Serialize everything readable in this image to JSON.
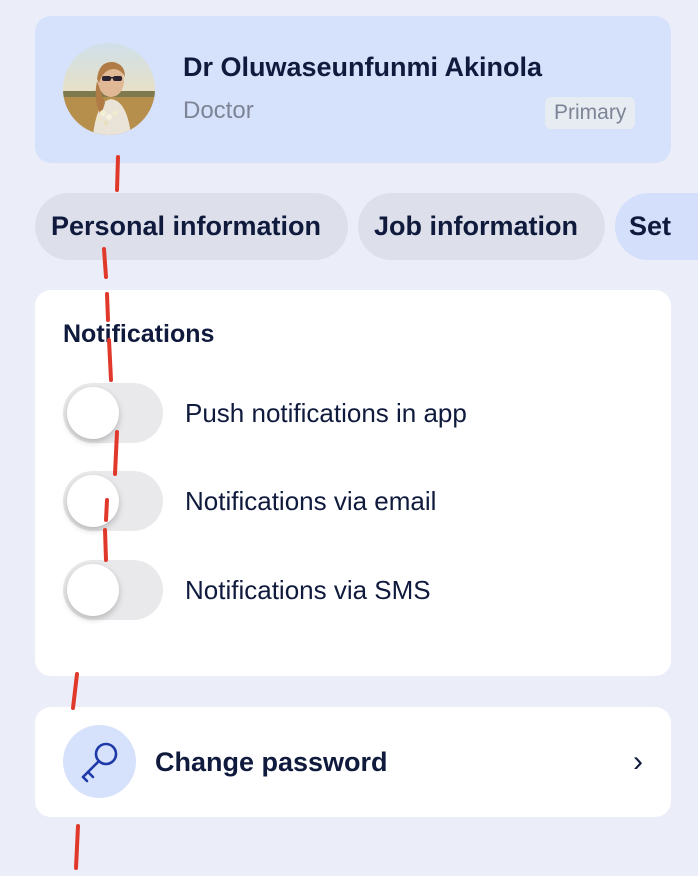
{
  "profile": {
    "name": "Dr Oluwaseunfunmi Akinola",
    "role": "Doctor",
    "badge": "Primary"
  },
  "tabs": [
    {
      "label": "Personal information"
    },
    {
      "label": "Job information"
    },
    {
      "label": "Set"
    }
  ],
  "notifications": {
    "title": "Notifications",
    "items": [
      {
        "label": "Push notifications in app",
        "enabled": false
      },
      {
        "label": "Notifications via email",
        "enabled": false
      },
      {
        "label": "Notifications via SMS",
        "enabled": false
      }
    ]
  },
  "password": {
    "label": "Change password",
    "icon": "key-icon",
    "chevron": "›"
  },
  "colors": {
    "background": "#ebeef8",
    "profile_card": "#d6e2fb",
    "text_primary": "#0f1a3d",
    "text_secondary": "#7d8496",
    "annotation": "#e0392b"
  }
}
